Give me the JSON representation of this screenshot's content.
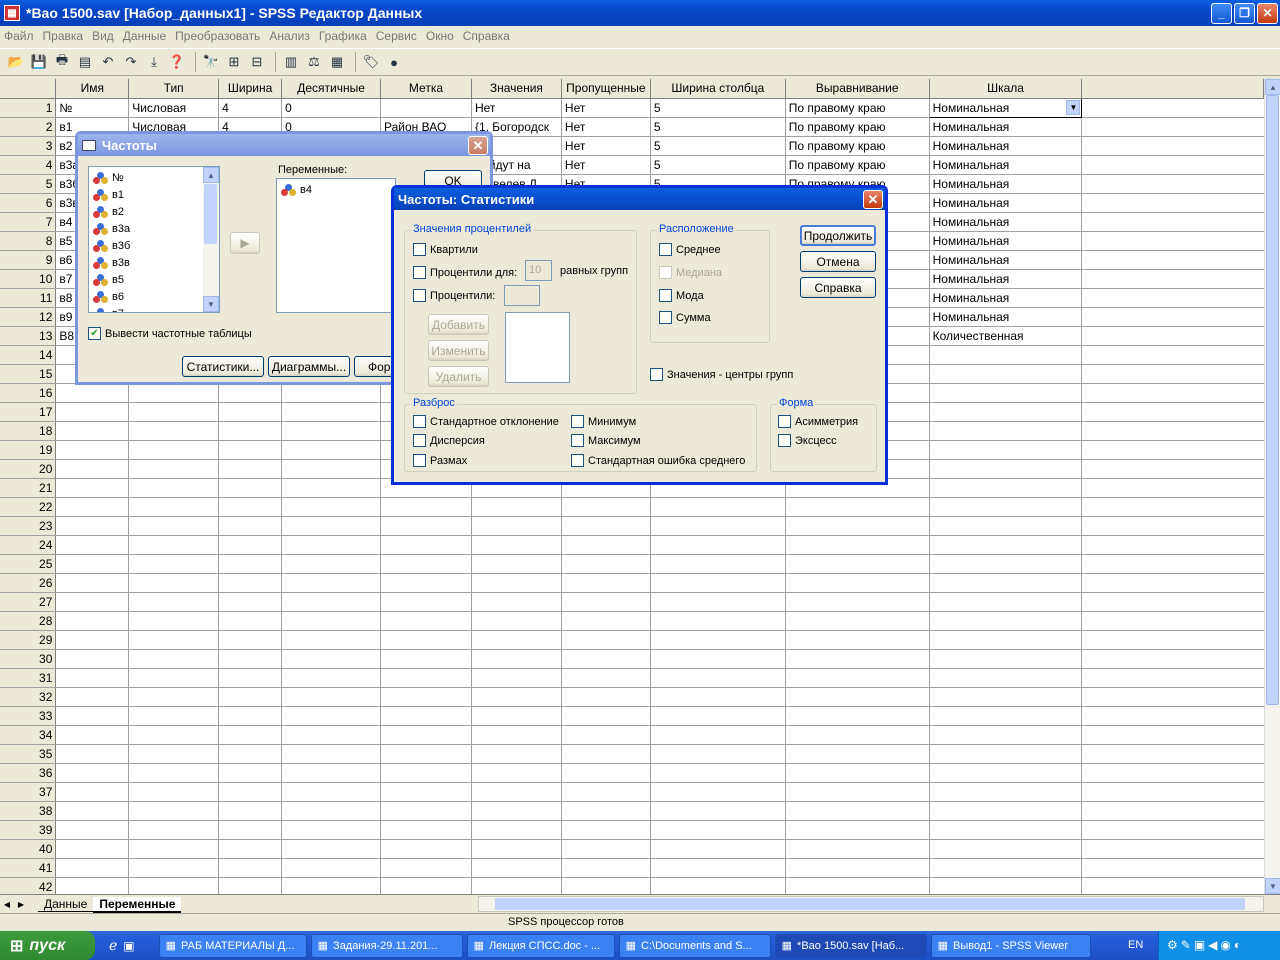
{
  "window": {
    "title": "*Вао 1500.sav [Набор_данных1] - SPSS Редактор Данных",
    "app_icon": "spss-icon"
  },
  "menu": [
    "Файл",
    "Правка",
    "Вид",
    "Данные",
    "Преобразовать",
    "Анализ",
    "Графика",
    "Сервис",
    "Окно",
    "Справка"
  ],
  "columns": [
    "Имя",
    "Тип",
    "Ширина",
    "Десятичные",
    "Метка",
    "Значения",
    "Пропущенные",
    "Ширина столбца",
    "Выравнивание",
    "Шкала"
  ],
  "rows": [
    [
      "№",
      "Числовая",
      "4",
      "0",
      "",
      "Нет",
      "Нет",
      "5",
      "По правому краю",
      "Номинальная"
    ],
    [
      "в1",
      "Числовая",
      "4",
      "0",
      "Район ВАО",
      "{1, Богородск",
      "Нет",
      "5",
      "По правому краю",
      "Номинальная"
    ],
    [
      "в2",
      "",
      "",
      "",
      "",
      "",
      "Нет",
      "5",
      "По правому краю",
      "Номинальная"
    ],
    [
      "в3а",
      "",
      "",
      "",
      "",
      "лойдут на",
      "Нет",
      "5",
      "По правому краю",
      "Номинальная"
    ],
    [
      "в3б",
      "",
      "",
      "",
      "",
      "Щавелев Д",
      "Нет",
      "5",
      "По правому краю",
      "Номинальная"
    ],
    [
      "в3в",
      "",
      "",
      "",
      "",
      "",
      "",
      "",
      "",
      "Номинальная"
    ],
    [
      "в4",
      "",
      "",
      "",
      "",
      "",
      "",
      "",
      "",
      "Номинальная"
    ],
    [
      "в5",
      "",
      "",
      "",
      "",
      "",
      "",
      "",
      "",
      "Номинальная"
    ],
    [
      "в6",
      "",
      "",
      "",
      "",
      "",
      "",
      "",
      "",
      "Номинальная"
    ],
    [
      "в7",
      "",
      "",
      "",
      "",
      "",
      "",
      "",
      "",
      "Номинальная"
    ],
    [
      "в8",
      "",
      "",
      "",
      "",
      "",
      "",
      "",
      "",
      "Номинальная"
    ],
    [
      "в9",
      "",
      "",
      "",
      "",
      "",
      "",
      "",
      "",
      "Номинальная"
    ],
    [
      "В8",
      "",
      "",
      "",
      "",
      "",
      "",
      "",
      "",
      "Количественная"
    ]
  ],
  "row_numbers": [
    "1",
    "2",
    "3",
    "4",
    "5",
    "6",
    "7",
    "8",
    "9",
    "10",
    "11",
    "12",
    "13",
    "14",
    "15",
    "16",
    "17",
    "18",
    "19",
    "20",
    "21",
    "22",
    "23",
    "24",
    "25",
    "26",
    "27",
    "28",
    "29",
    "30",
    "31",
    "32",
    "33",
    "34",
    "35",
    "36",
    "37",
    "38",
    "39",
    "40",
    "41",
    "42"
  ],
  "sheet_tabs": {
    "data": "Данные",
    "variables": "Переменные"
  },
  "status": "SPSS процессор готов",
  "freq_dialog": {
    "title": "Частоты",
    "source_vars": [
      "№",
      "в1",
      "в2",
      "в3а",
      "в3б",
      "в3в",
      "в5",
      "в6",
      "в7"
    ],
    "target_label": "Переменные:",
    "target_vars": [
      "в4"
    ],
    "ok": "OK",
    "show_tables": "Вывести частотные таблицы",
    "btn_stats": "Статистики...",
    "btn_charts": "Диаграммы...",
    "btn_format": "Фор"
  },
  "stats_dialog": {
    "title": "Частоты: Статистики",
    "percentiles_group": "Значения процентилей",
    "quartiles": "Квартили",
    "cutpoints": "Процентили для:",
    "cutpoints_value": "10",
    "equal_groups": "равных групп",
    "percentiles": "Процентили:",
    "add": "Добавить",
    "change": "Изменить",
    "remove": "Удалить",
    "central_group": "Расположение",
    "mean": "Среднее",
    "median": "Медиана",
    "mode": "Мода",
    "sum": "Сумма",
    "midpoints": "Значения - центры групп",
    "dispersion_group": "Разброс",
    "std": "Стандартное отклонение",
    "variance": "Дисперсия",
    "range": "Размах",
    "min": "Минимум",
    "max": "Максимум",
    "se_mean": "Стандартная ошибка среднего",
    "distribution_group": "Форма",
    "skewness": "Асимметрия",
    "kurtosis": "Эксцесс",
    "continue": "Продолжить",
    "cancel": "Отмена",
    "help": "Справка"
  },
  "taskbar": {
    "start": "пуск",
    "tasks": [
      "РАБ МАТЕРИАЛЫ Д...",
      "Задания-29.11.201...",
      "Лекция СПСС.doc - ...",
      "C:\\Documents and S...",
      "*Вао 1500.sav [Наб...",
      "Вывод1 - SPSS Viewer"
    ],
    "lang": "EN"
  }
}
